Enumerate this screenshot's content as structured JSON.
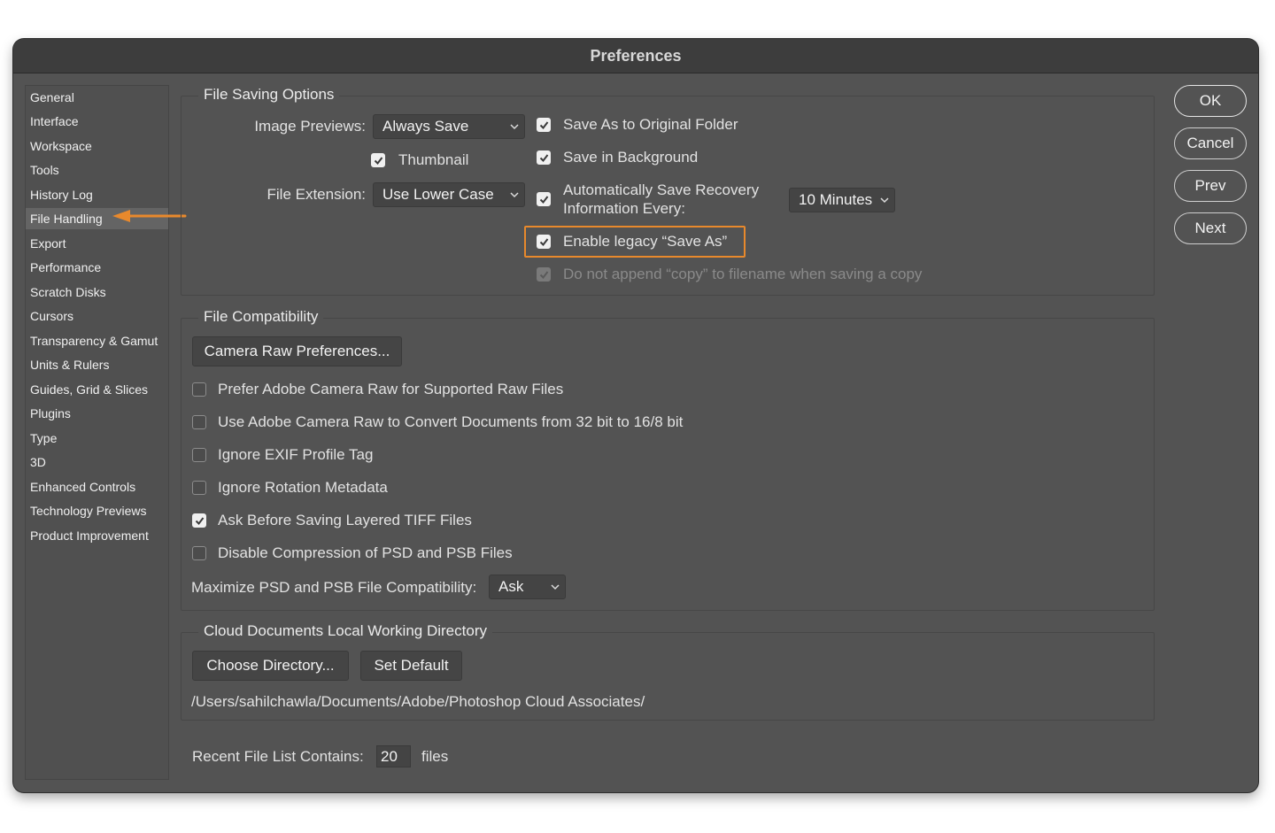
{
  "window": {
    "title": "Preferences"
  },
  "sidebar": {
    "items": [
      {
        "label": "General"
      },
      {
        "label": "Interface"
      },
      {
        "label": "Workspace"
      },
      {
        "label": "Tools"
      },
      {
        "label": "History Log"
      },
      {
        "label": "File Handling",
        "selected": true
      },
      {
        "label": "Export"
      },
      {
        "label": "Performance"
      },
      {
        "label": "Scratch Disks"
      },
      {
        "label": "Cursors"
      },
      {
        "label": "Transparency & Gamut"
      },
      {
        "label": "Units & Rulers"
      },
      {
        "label": "Guides, Grid & Slices"
      },
      {
        "label": "Plugins"
      },
      {
        "label": "Type"
      },
      {
        "label": "3D"
      },
      {
        "label": "Enhanced Controls"
      },
      {
        "label": "Technology Previews"
      },
      {
        "label": "Product Improvement"
      }
    ]
  },
  "file_saving": {
    "title": "File Saving Options",
    "image_previews_label": "Image Previews:",
    "image_previews_value": "Always Save",
    "thumbnail_label": "Thumbnail",
    "file_extension_label": "File Extension:",
    "file_extension_value": "Use Lower Case",
    "save_original_folder": "Save As to Original Folder",
    "save_background": "Save in Background",
    "auto_save_line1": "Automatically Save Recovery",
    "auto_save_line2": "Information Every:",
    "auto_save_value": "10 Minutes",
    "legacy_save_as": "Enable legacy “Save As”",
    "no_append_copy": "Do not append “copy” to filename when saving a copy"
  },
  "file_compat": {
    "title": "File Compatibility",
    "camera_raw_button": "Camera Raw Preferences...",
    "options": [
      {
        "label": "Prefer Adobe Camera Raw for Supported Raw Files",
        "checked": false
      },
      {
        "label": "Use Adobe Camera Raw to Convert Documents from 32 bit to 16/8 bit",
        "checked": false
      },
      {
        "label": "Ignore EXIF Profile Tag",
        "checked": false
      },
      {
        "label": "Ignore Rotation Metadata",
        "checked": false
      },
      {
        "label": "Ask Before Saving Layered TIFF Files",
        "checked": true
      },
      {
        "label": "Disable Compression of PSD and PSB Files",
        "checked": false
      }
    ],
    "maximize_label": "Maximize PSD and PSB File Compatibility:",
    "maximize_value": "Ask"
  },
  "cloud": {
    "title": "Cloud Documents Local Working Directory",
    "choose_button": "Choose Directory...",
    "set_default_button": "Set Default",
    "path": "/Users/sahilchawla/Documents/Adobe/Photoshop Cloud Associates/"
  },
  "recent": {
    "label": "Recent File List Contains:",
    "value": "20",
    "suffix": "files"
  },
  "buttons": {
    "ok": "OK",
    "cancel": "Cancel",
    "prev": "Prev",
    "next": "Next"
  },
  "colors": {
    "highlight": "#e8892c",
    "window_bg": "#535353"
  }
}
